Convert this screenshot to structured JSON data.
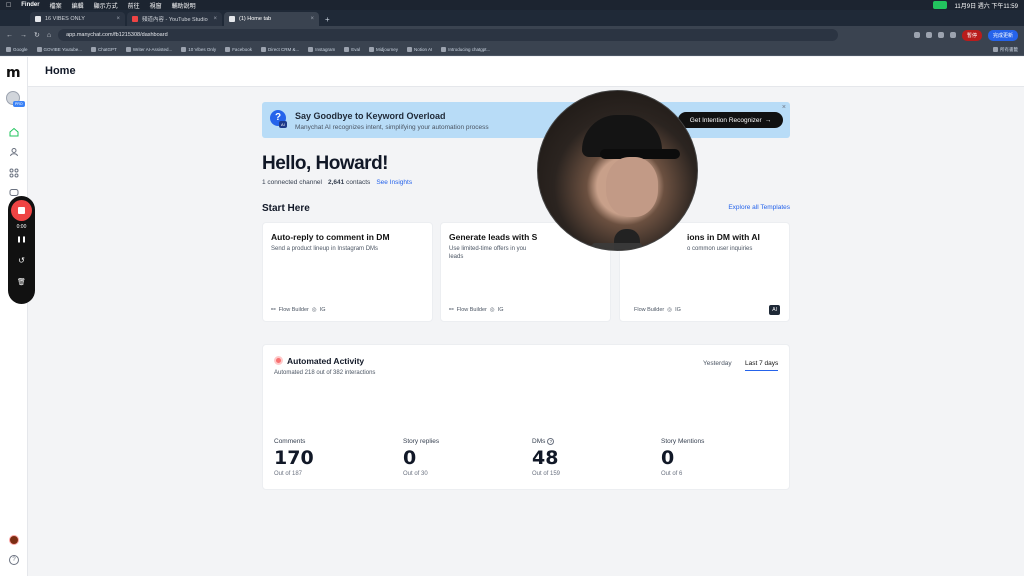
{
  "menubar": {
    "app": "Finder",
    "items": [
      "檔案",
      "編輯",
      "顯示方式",
      "前往",
      "視窗",
      "輔助說明"
    ],
    "clock": "11月9日 週六 下午11:59"
  },
  "tabs": [
    {
      "label": "16 VIBES ONLY"
    },
    {
      "label": "頻道內容 - YouTube Studio"
    },
    {
      "label": "(1) Home tab"
    }
  ],
  "address": {
    "url": "app.manychat.com/fb1215308/dashboard",
    "pause_label": "暫停",
    "update_label": "完成更新"
  },
  "bookmarks": [
    "Google",
    "GOVIBE Youtube...",
    "ChatGPT",
    "Writer AI-Assisted...",
    "10 Vibes Only",
    "Facebook",
    "Direct CRM &...",
    "Instagram",
    "Eval",
    "Midjourney",
    "Notion AI",
    "Introducing chatgpt..."
  ],
  "bookmarks_right": "所有書籤",
  "sidebar": {
    "logo": "m",
    "pro_badge": "PRO"
  },
  "page": {
    "title": "Home"
  },
  "recorder": {
    "time": "0:00",
    "pause": "❚❚",
    "restart": "↺",
    "delete": "🗑"
  },
  "banner": {
    "title": "Say Goodbye to Keyword Overload",
    "subtitle": "Manychat AI recognizes intent, simplifying your automation process",
    "button": "Get Intention Recognizer",
    "icon_glyph": "?",
    "ai_badge": "AI"
  },
  "greeting": "Hello, Howard!",
  "stats": {
    "channels": "1 connected channel",
    "contacts_count": "2,641",
    "contacts_label": "contacts",
    "insights": "See Insights"
  },
  "start_here": {
    "title": "Start Here",
    "explore": "Explore all Templates"
  },
  "cards": [
    {
      "title": "Auto-reply to comment in DM",
      "desc": "Send a product lineup in Instagram DMs",
      "foot": "Flow Builder",
      "platform": "IG"
    },
    {
      "title": "Generate leads with S",
      "desc": "Use limited-time offers in you",
      "desc2": "leads",
      "foot": "Flow Builder",
      "platform": "IG"
    },
    {
      "title": "ions in DM with AI",
      "desc": "o common user inquiries",
      "foot": "Flow Builder",
      "platform": "IG",
      "badge": "AI"
    }
  ],
  "activity": {
    "title": "Automated Activity",
    "subtitle": "Automated 218 out of 382 interactions",
    "ranges": [
      "Yesterday",
      "Last 7 days"
    ],
    "metrics": [
      {
        "label": "Comments",
        "value": "170",
        "out": "Out of 187"
      },
      {
        "label": "Story replies",
        "value": "0",
        "out": "Out of 30"
      },
      {
        "label": "DMs",
        "value": "48",
        "out": "Out of 159",
        "info": "?"
      },
      {
        "label": "Story Mentions",
        "value": "0",
        "out": "Out of 6"
      }
    ]
  },
  "help_glyph": "?"
}
